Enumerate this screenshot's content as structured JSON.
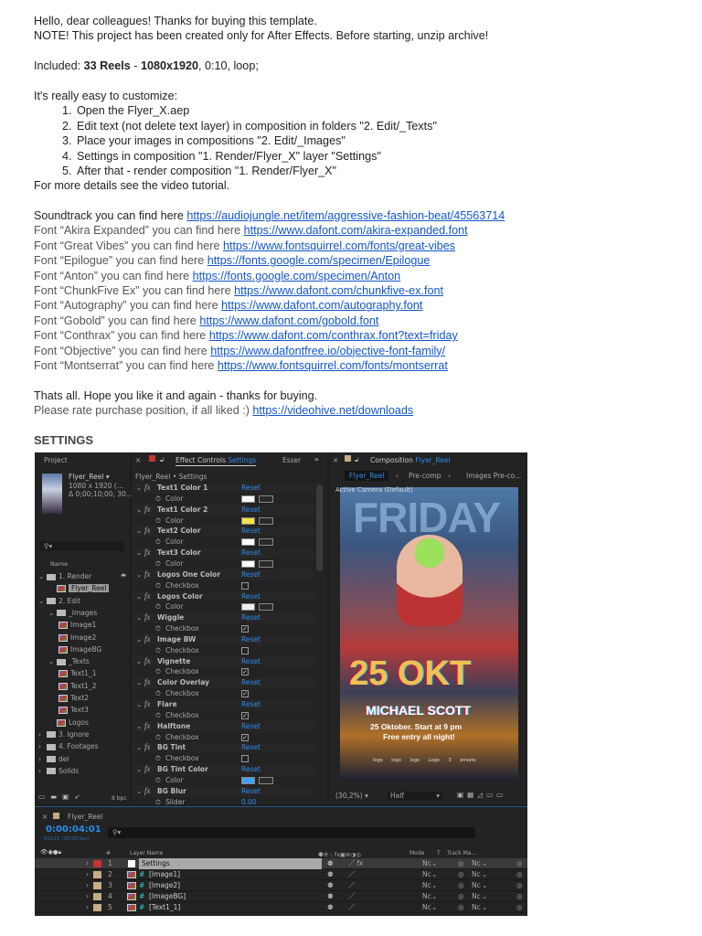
{
  "doc": {
    "greeting": "Hello, dear colleagues! Thanks for buying this template.",
    "note": "NOTE! This project has been created only for After Effects. Before starting, unzip archive!",
    "included_prefix": "Included: ",
    "included_reels": "33 Reels",
    "included_sep": " - ",
    "included_res": "1080x1920",
    "included_rest": ", 0:10, loop;",
    "easy": "It's really easy to customize:",
    "steps": [
      "Open the Flyer_X.aep",
      "Edit text (not delete text layer) in composition in folders \"2. Edit/_Texts\"",
      "Place your images in compositions \"2. Edit/_Images\"",
      "Settings in composition \"1. Render/Flyer_X\" layer \"Settings\"",
      "After that - render composition \"1. Render/Flyer_X\""
    ],
    "details": "For more details see the video tutorial.",
    "soundtrack_label": "Soundtrack you can find here ",
    "soundtrack_url": "https://audiojungle.net/item/aggressive-fashion-beat/45563714",
    "fonts": [
      {
        "label": "Font “Akira Expanded” you can find here ",
        "url": "https://www.dafont.com/akira-expanded.font"
      },
      {
        "label": "Font “Great Vibes” you can find here ",
        "url": "https://www.fontsquirrel.com/fonts/great-vibes"
      },
      {
        "label": "Font “Epilogue” you can find here ",
        "url": "https://fonts.google.com/specimen/Epilogue"
      },
      {
        "label": "Font “Anton” you can find here ",
        "url": "https://fonts.google.com/specimen/Anton"
      },
      {
        "label": "Font “ChunkFive Ex” you can find here ",
        "url": "https://www.dafont.com/chunkfive-ex.font"
      },
      {
        "label": "Font “Autography” you can find here ",
        "url": "https://www.dafont.com/autography.font"
      },
      {
        "label": "Font “Gobold” you can find here ",
        "url": "https://www.dafont.com/gobold.font"
      },
      {
        "label": "Font “Conthrax” you can find here ",
        "url": "https://www.dafont.com/conthrax.font?text=friday"
      },
      {
        "label": "Font “Objective” you can find here ",
        "url": "https://www.dafontfree.io/objective-font-family/"
      },
      {
        "label": "Font “Montserrat” you can find here ",
        "url": "https://www.fontsquirrel.com/fonts/montserrat"
      }
    ],
    "thats_all": "Thats all. Hope you like it and again - thanks for buying.",
    "rate": "Please rate purchase position, if all liked :) ",
    "rate_url": "https://videohive.net/downloads",
    "settings_heading": "SETTINGS"
  },
  "ae": {
    "project": {
      "title": "Project",
      "comp_name": "Flyer_Reel ▾",
      "comp_res": "1080 x 1920  (...",
      "comp_dur": "Δ 0;00;10;00, 30...",
      "name_col": "Name",
      "bpc": "8 bpc",
      "tree": [
        {
          "label": "1. Render",
          "type": "folder",
          "depth": 0,
          "open": true
        },
        {
          "label": "Flyer_Reel",
          "type": "comp",
          "depth": 1,
          "selected": true
        },
        {
          "label": "2. Edit",
          "type": "folder",
          "depth": 0,
          "open": true
        },
        {
          "label": "_Images",
          "type": "folder",
          "depth": 1,
          "open": true
        },
        {
          "label": "Image1",
          "type": "comp",
          "depth": 2
        },
        {
          "label": "Image2",
          "type": "comp",
          "depth": 2
        },
        {
          "label": "ImageBG",
          "type": "comp",
          "depth": 2
        },
        {
          "label": "_Texts",
          "type": "folder",
          "depth": 1,
          "open": true
        },
        {
          "label": "Text1_1",
          "type": "comp",
          "depth": 2
        },
        {
          "label": "Text1_2",
          "type": "comp",
          "depth": 2
        },
        {
          "label": "Text2",
          "type": "comp",
          "depth": 2
        },
        {
          "label": "Text3",
          "type": "comp",
          "depth": 2
        },
        {
          "label": "Logos",
          "type": "comp",
          "depth": 1
        },
        {
          "label": "3. Ignore",
          "type": "folder",
          "depth": 0
        },
        {
          "label": "4. Footages",
          "type": "folder",
          "depth": 0
        },
        {
          "label": "del",
          "type": "folder",
          "depth": 0
        },
        {
          "label": "Solids",
          "type": "folder",
          "depth": 0
        }
      ]
    },
    "effects": {
      "tab_label": "Effect Controls",
      "tab_layer": "Settings",
      "other_tab": "Esser",
      "subtitle": "Flyer_Reel • Settings",
      "reset": "Reset",
      "items": [
        {
          "name": "Text1 Color 1",
          "prop": "Color",
          "kind": "color",
          "color": "#ffffff"
        },
        {
          "name": "Text1 Color 2",
          "prop": "Color",
          "kind": "color",
          "color": "#f5e04a"
        },
        {
          "name": "Text2 Color",
          "prop": "Color",
          "kind": "color",
          "color": "#ffffff"
        },
        {
          "name": "Text3 Color",
          "prop": "Color",
          "kind": "color",
          "color": "#ffffff"
        },
        {
          "name": "Logos One Color",
          "prop": "Checkbox",
          "kind": "check",
          "checked": false
        },
        {
          "name": "Logos Color",
          "prop": "Color",
          "kind": "color",
          "color": "#eeeeee"
        },
        {
          "name": "Wiggle",
          "prop": "Checkbox",
          "kind": "check",
          "checked": true
        },
        {
          "name": "Image BW",
          "prop": "Checkbox",
          "kind": "check",
          "checked": false
        },
        {
          "name": "Vignette",
          "prop": "Checkbox",
          "kind": "check",
          "checked": true
        },
        {
          "name": "Color Overlay",
          "prop": "Checkbox",
          "kind": "check",
          "checked": true
        },
        {
          "name": "Flare",
          "prop": "Checkbox",
          "kind": "check",
          "checked": true
        },
        {
          "name": "Halftone",
          "prop": "Checkbox",
          "kind": "check",
          "checked": true
        },
        {
          "name": "BG Tint",
          "prop": "Checkbox",
          "kind": "check",
          "checked": false
        },
        {
          "name": "BG Tint Color",
          "prop": "Color",
          "kind": "color",
          "color": "#3fa0f5"
        },
        {
          "name": "BG Blur",
          "prop": "Slider",
          "kind": "slider",
          "value": "0.00"
        }
      ]
    },
    "comp": {
      "tab_label": "Composition",
      "tab_comp": "Flyer_Reel",
      "crumbs": [
        "Flyer_Reel",
        "Pre-comp",
        "Images Pre-co..."
      ],
      "camera": "Active Camera (Default)",
      "poster": {
        "headline": "FRIDAY",
        "date": "25 OKT",
        "name": "MICHAEL SCOTT",
        "line1": "25 Oktober. Start at 9 pm",
        "line2": "Free entry all night!",
        "logos": [
          "logo",
          "logo",
          "logo",
          "Logo 3",
          "envato"
        ]
      },
      "zoom": "(30,2%)",
      "quality": "Half"
    },
    "timeline": {
      "comp": "Flyer_Reel",
      "timecode": "0:00:04:01",
      "frames": "00121 (30.00 fps)",
      "col_num": "#",
      "col_name": "Layer Name",
      "col_mode": "Mode",
      "col_t": "T",
      "col_track": "Track Ma...",
      "layers": [
        {
          "num": "1",
          "name": "Settings",
          "label_color": "#c23434",
          "type": "solid",
          "fx": true,
          "selected": true
        },
        {
          "num": "2",
          "name": "[Image1]",
          "label_color": "#c4ad86",
          "type": "comp"
        },
        {
          "num": "3",
          "name": "[Image2]",
          "label_color": "#c4ad86",
          "type": "comp"
        },
        {
          "num": "4",
          "name": "[ImageBG]",
          "label_color": "#c4ad86",
          "type": "comp"
        },
        {
          "num": "5",
          "name": "[Text1_1]",
          "label_color": "#c4ad86",
          "type": "comp"
        }
      ],
      "mode_value": "Nc"
    }
  }
}
